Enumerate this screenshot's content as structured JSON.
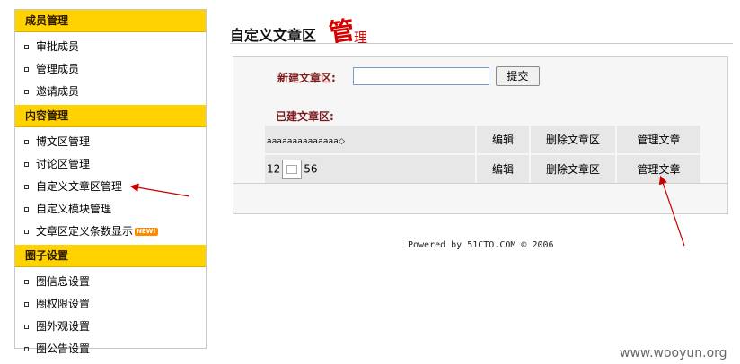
{
  "sidebar": {
    "sections": [
      {
        "title": "成员管理",
        "items": [
          "审批成员",
          "管理成员",
          "邀请成员"
        ]
      },
      {
        "title": "内容管理",
        "items": [
          "博文区管理",
          "讨论区管理",
          "自定义文章区管理",
          "自定义模块管理",
          "文章区定义条数显示"
        ]
      },
      {
        "title": "圈子设置",
        "items": [
          "圈信息设置",
          "圈权限设置",
          "圈外观设置",
          "圈公告设置"
        ]
      }
    ],
    "new_badge": "NEW!"
  },
  "page": {
    "title": "自定义文章区",
    "title_deco": [
      "管",
      "理"
    ]
  },
  "form": {
    "new_label": "新建文章区:",
    "input_value": "",
    "submit_label": "提交",
    "existing_label": "已建文章区:"
  },
  "articles": [
    {
      "name": "aaaaaaaaaaaaaa◇",
      "edit": "编辑",
      "delete": "删除文章区",
      "manage": "管理文章"
    },
    {
      "name_prefix": "12",
      "name_suffix": "56",
      "edit": "编辑",
      "delete": "删除文章区",
      "manage": "管理文章"
    }
  ],
  "footer": "Powered by 51CTO.COM © 2006",
  "watermark": "www.wooyun.org",
  "colors": {
    "section_header": "#ffd200",
    "arrow": "#c80000",
    "label": "#7a1a1a"
  }
}
